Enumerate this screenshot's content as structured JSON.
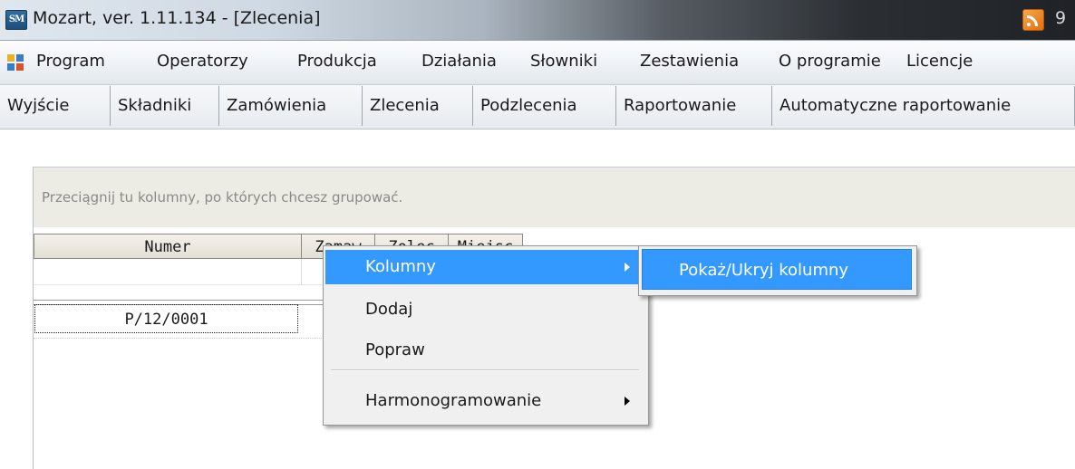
{
  "window": {
    "title": "Mozart, ver. 1.11.134 - [Zlecenia]",
    "title_extra": "9",
    "app_icon_label": "SM"
  },
  "menubar": {
    "items": [
      "Program",
      "Operatorzy",
      "Produkcja",
      "Działania",
      "Słowniki",
      "Zestawienia",
      "O programie",
      "Licencje"
    ]
  },
  "toolbar": {
    "buttons": [
      "Wyjście",
      "Składniki",
      "Zamówienia",
      "Zlecenia",
      "Podzlecenia",
      "Raportowanie",
      "Automatyczne raportowanie"
    ]
  },
  "grid": {
    "group_hint": "Przeciągnij tu kolumny, po których chcesz grupować.",
    "columns": [
      "Numer",
      "Zamaw",
      "Zolec",
      "Miejsc"
    ],
    "rows": [
      {
        "numer": "P/12/0001"
      }
    ]
  },
  "context_menu": {
    "items": [
      {
        "label": "Kolumny",
        "has_submenu": true,
        "highlighted": true
      },
      {
        "label": "Dodaj",
        "has_submenu": false
      },
      {
        "label": "Popraw",
        "has_submenu": false
      },
      {
        "label": "Harmonogramowanie",
        "has_submenu": true
      }
    ]
  },
  "submenu": {
    "items": [
      {
        "label": "Pokaż/Ukryj kolumny",
        "highlighted": true
      }
    ]
  },
  "colors": {
    "highlight": "#3399ff",
    "group_bar": "#ecebe4",
    "menu_background": "#f0f0f0"
  }
}
